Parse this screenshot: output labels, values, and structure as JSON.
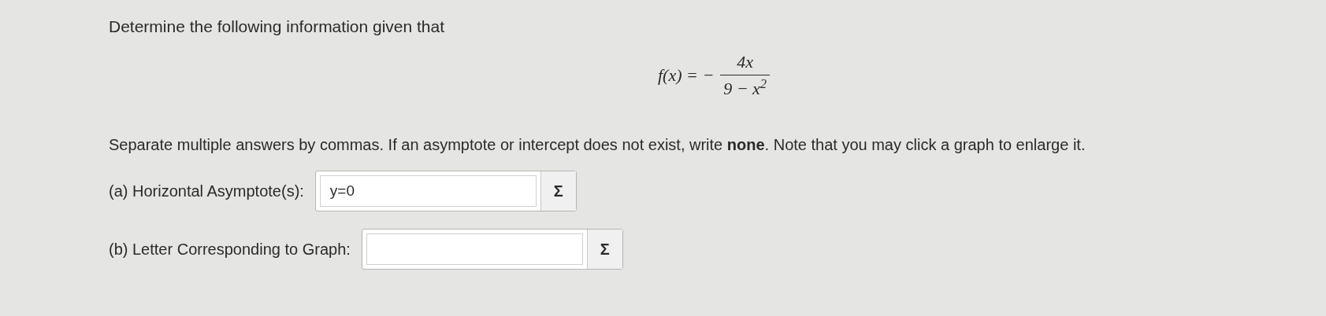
{
  "intro": "Determine the following information given that",
  "formula": {
    "lhs": "f(x) = −",
    "numerator": "4x",
    "denominator": "9 − x$^{2}$"
  },
  "instructions": "Separate multiple answers by commas. If an asymptote or intercept does not exist, write **none**. Note that you may click a graph to enlarge it.",
  "questions": [
    {
      "label": "(a) Horizontal Asymptote(s):",
      "value": "y=0",
      "button": "Σ"
    },
    {
      "label": "(b) Letter Corresponding to Graph:",
      "button": "Σ"
    }
  ]
}
